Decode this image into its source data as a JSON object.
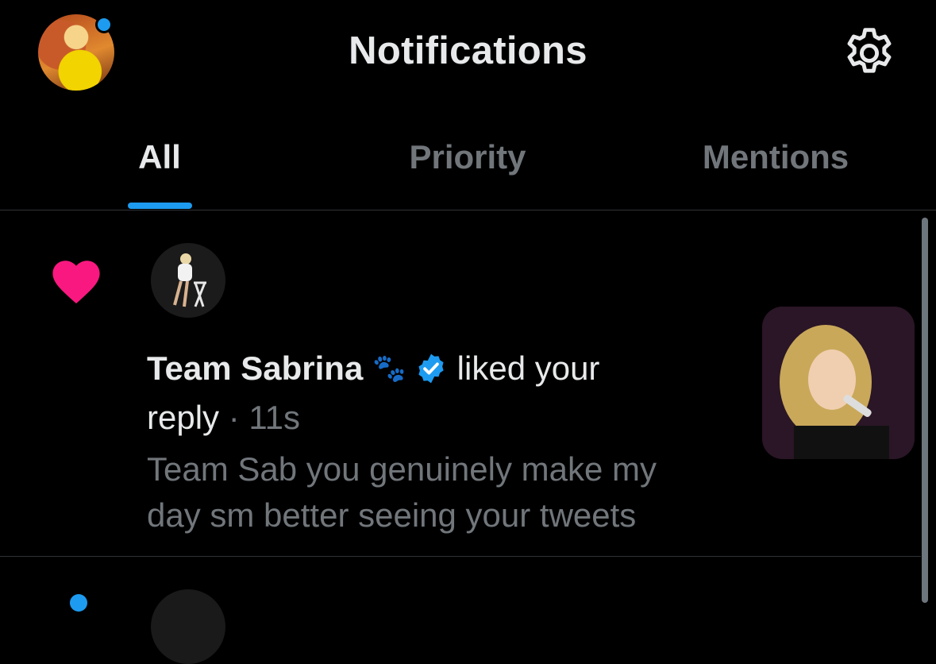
{
  "header": {
    "title": "Notifications",
    "profile_avatar": "profile-avatar",
    "settings_icon": "gear-icon"
  },
  "tabs": [
    {
      "label": "All",
      "active": true
    },
    {
      "label": "Priority",
      "active": false
    },
    {
      "label": "Mentions",
      "active": false
    }
  ],
  "notification": {
    "icon": "heart-icon",
    "user_name": "Team Sabrina",
    "name_emoji": "🐾",
    "verified_icon": "verified-badge-icon",
    "action": "liked your",
    "action_cont": "reply",
    "separator": "·",
    "time": "11s",
    "text": "Team Sab you genuinely make my day sm better seeing your tweets"
  },
  "colors": {
    "background": "#000000",
    "accent": "#1d9bf0",
    "heart": "#f91880",
    "muted": "#71767b"
  }
}
